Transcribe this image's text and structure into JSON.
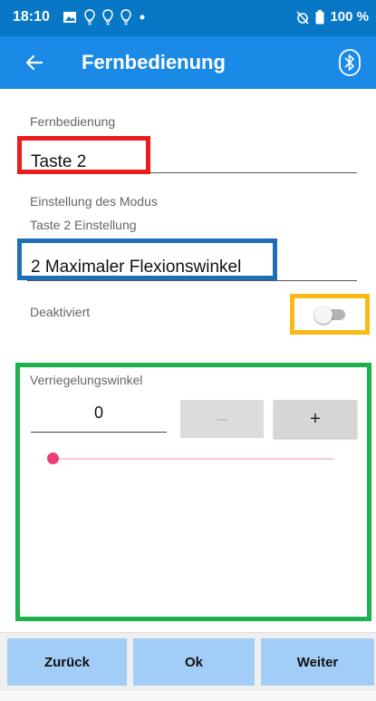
{
  "status_bar": {
    "time": "18:10",
    "icons": [
      "image-icon",
      "lightbulb-icon",
      "lightbulb-icon",
      "lightbulb-icon",
      "dot-icon"
    ],
    "battery_text": "100 %",
    "background": "#0877c5"
  },
  "app_bar": {
    "title": "Fernbedienung",
    "back_icon": "arrow-left-icon",
    "action_icon": "bluetooth-icon",
    "background": "#1a8ae6"
  },
  "form": {
    "remote_label": "Fernbedienung",
    "remote_value": "Taste 2",
    "mode_label": "Einstellung des Modus",
    "key_setting_label": "Taste 2 Einstellung",
    "key_setting_value": "2 Maximaler Flexionswinkel",
    "toggle_label": "Deaktiviert",
    "toggle_on": false
  },
  "lock_angle": {
    "label": "Verriegelungswinkel",
    "value": "0",
    "minus_label": "–",
    "plus_label": "+",
    "slider_fraction": 0,
    "accent_color": "#ea3e76"
  },
  "highlights": {
    "red": "#ea1c1c",
    "blue": "#1f6fb5",
    "yellow": "#fcb913",
    "green": "#1db24c"
  },
  "bottom_nav": {
    "back_label": "Zurück",
    "ok_label": "Ok",
    "next_label": "Weiter",
    "button_color": "#a2cdf6"
  }
}
